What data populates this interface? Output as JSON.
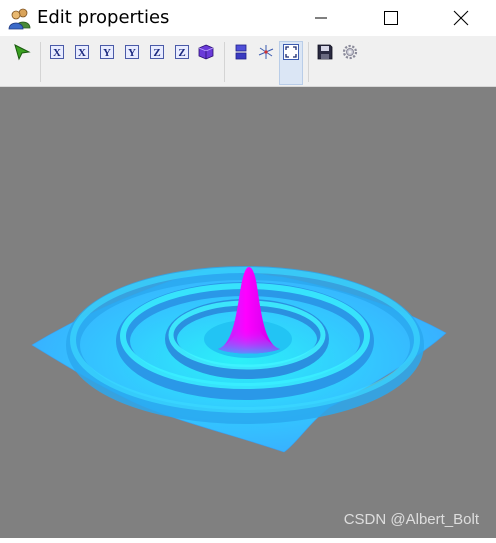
{
  "window": {
    "title": "Edit properties"
  },
  "toolbar": {
    "buttons": [
      {
        "name": "rotate-tool",
        "icon": "cursor-arrow-icon"
      },
      {
        "name": "x-axis-1",
        "label": "X"
      },
      {
        "name": "x-axis-2",
        "label": "X"
      },
      {
        "name": "y-axis-1",
        "label": "Y"
      },
      {
        "name": "y-axis-2",
        "label": "Y"
      },
      {
        "name": "z-axis-1",
        "label": "Z"
      },
      {
        "name": "z-axis-2",
        "label": "Z"
      },
      {
        "name": "cube-view",
        "icon": "cube-icon"
      },
      {
        "name": "colorbar",
        "icon": "colorbar-icon"
      },
      {
        "name": "axes-origin",
        "icon": "axes-icon"
      },
      {
        "name": "fit-view",
        "icon": "fullscreen-icon",
        "active": true
      },
      {
        "name": "save",
        "icon": "save-icon"
      },
      {
        "name": "settings",
        "icon": "gear-icon"
      }
    ]
  },
  "plot": {
    "background": "#808080",
    "colors": {
      "low": "#3aa8ff",
      "mid": "#2cf0f8",
      "peak": "#ff00ff"
    }
  },
  "watermark": "CSDN @Albert_Bolt"
}
